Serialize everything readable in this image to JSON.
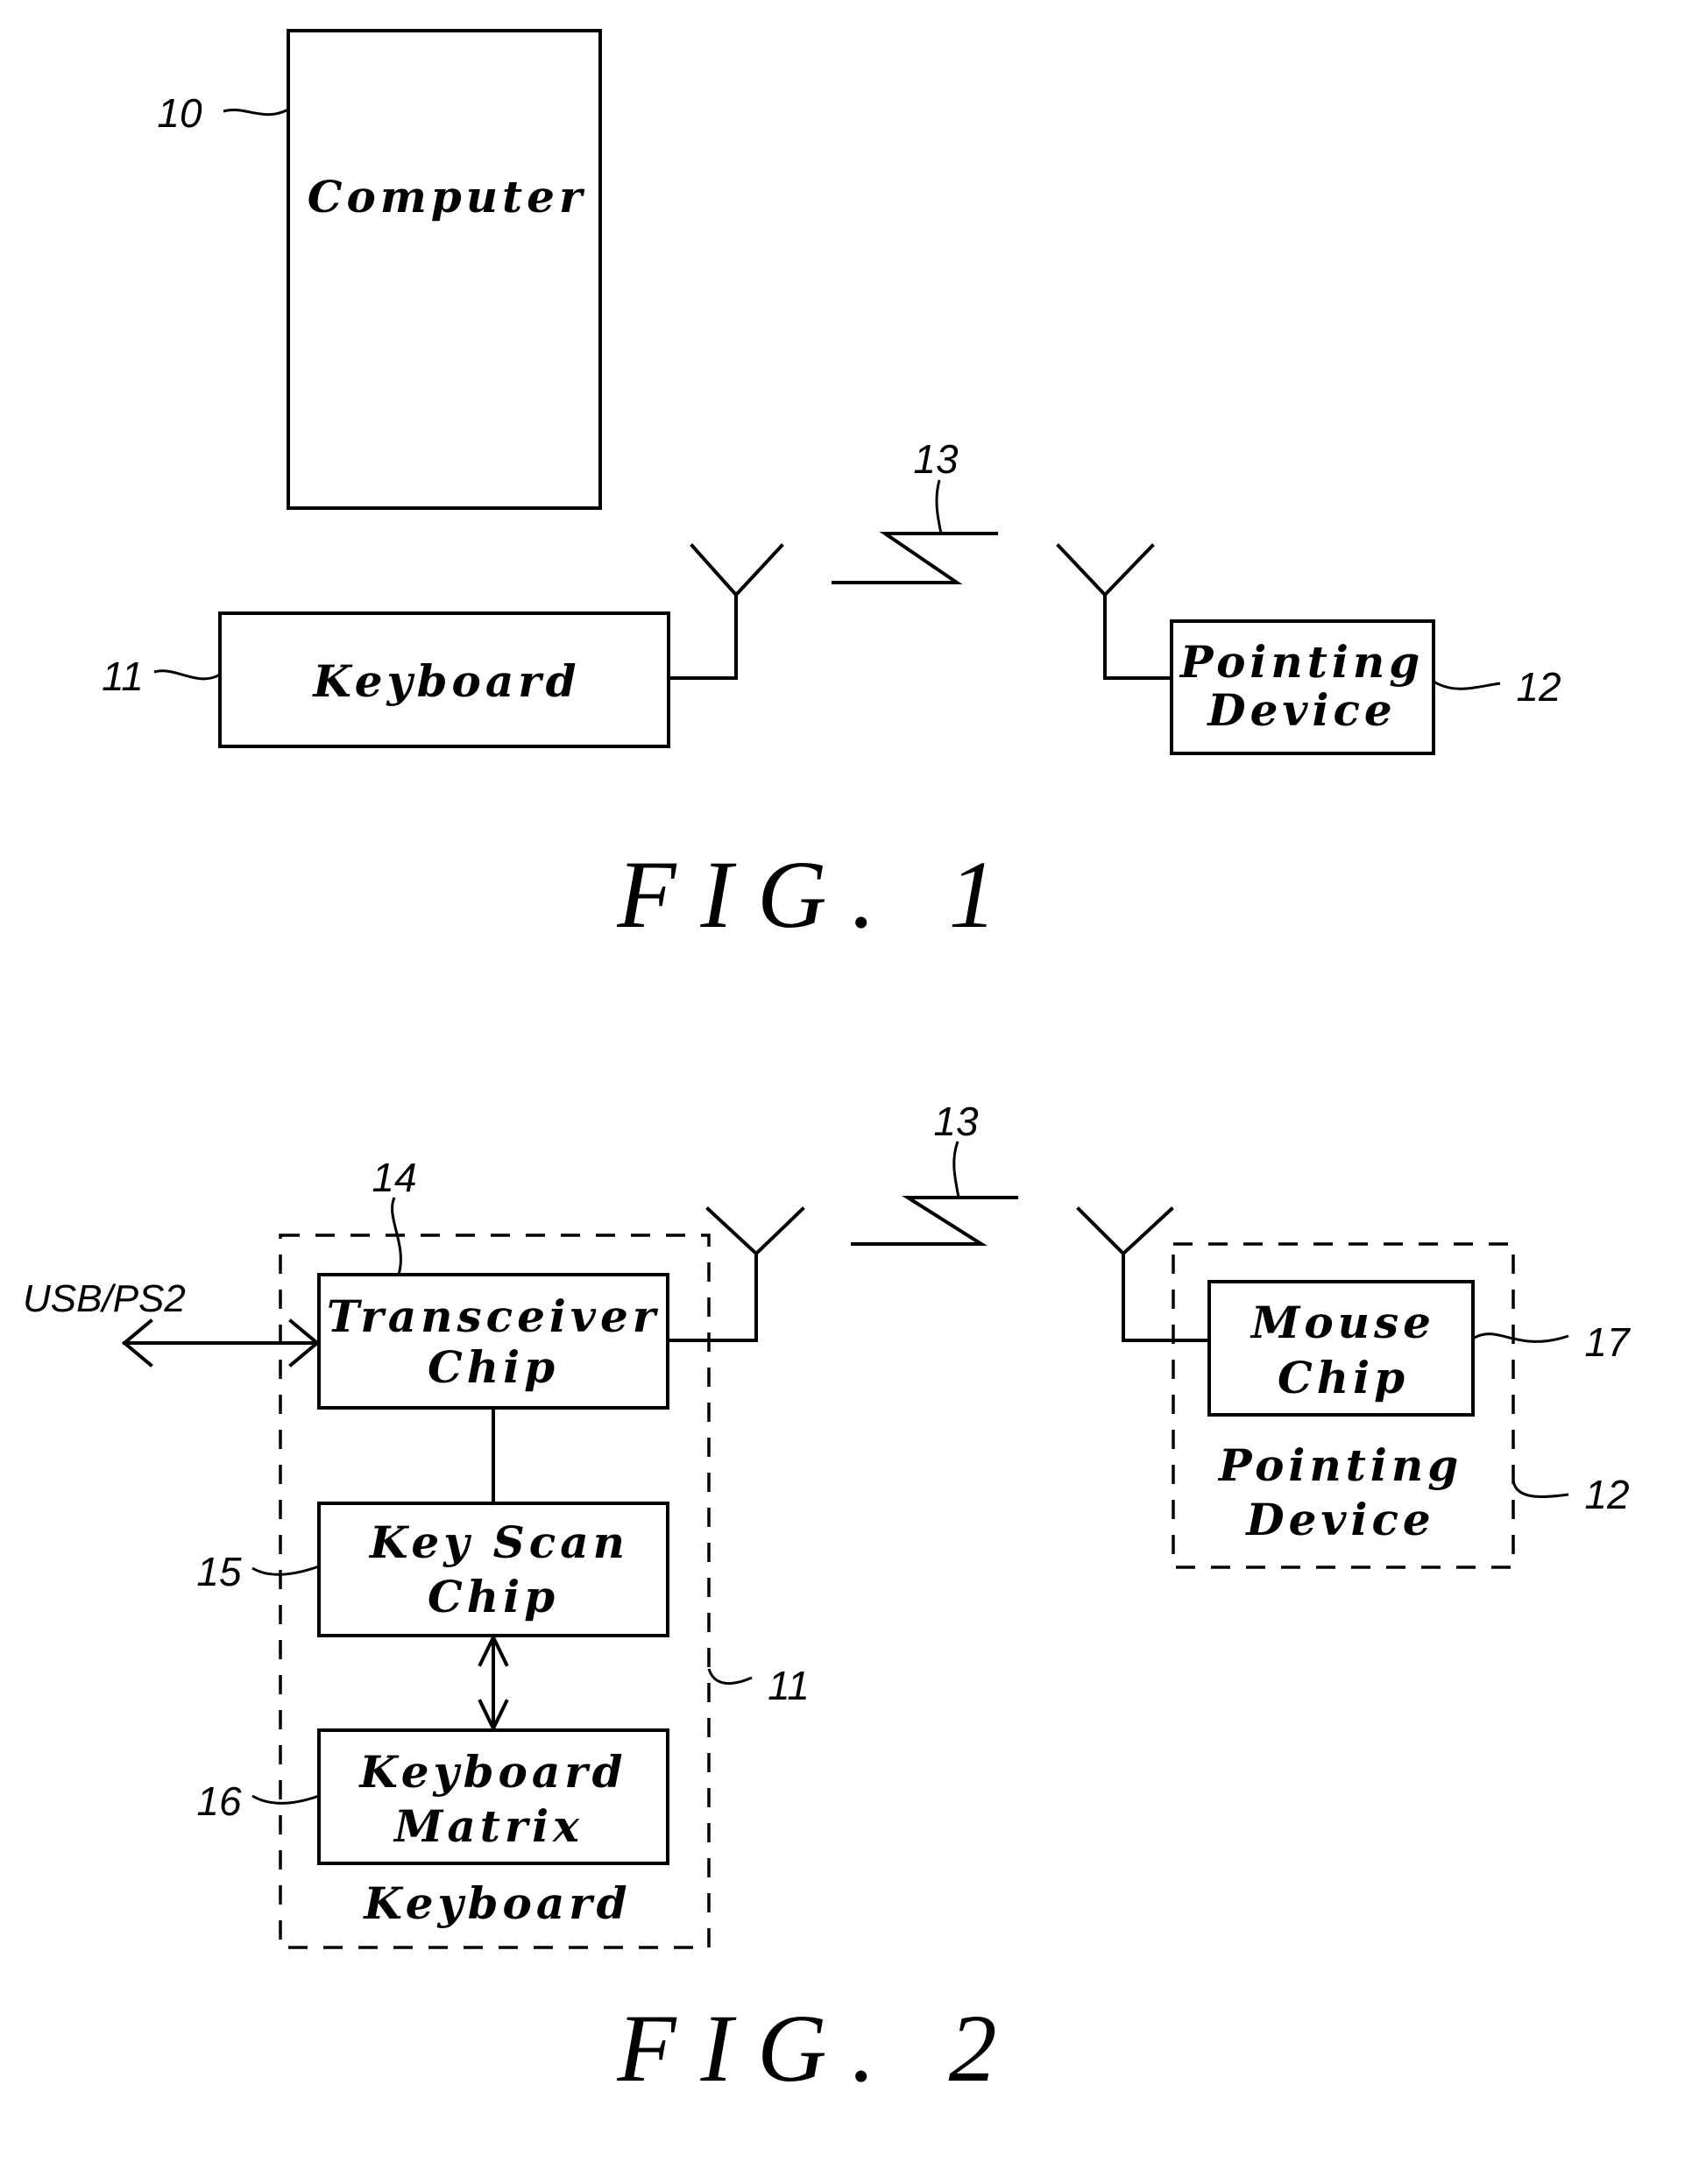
{
  "figure1": {
    "caption": "FIG. 1",
    "blocks": {
      "computer": {
        "label": "Computer",
        "ref": "10"
      },
      "keyboard": {
        "label": "Keyboard",
        "ref": "11"
      },
      "pointing_device": {
        "label_line1": "Pointing",
        "label_line2": "Device",
        "ref": "12"
      }
    },
    "wireless_link": {
      "ref": "13"
    }
  },
  "figure2": {
    "caption": "FIG. 2",
    "interface_label": "USB/PS2",
    "keyboard_group": {
      "label": "Keyboard",
      "ref": "11"
    },
    "blocks": {
      "transceiver_chip": {
        "label_line1": "Transceiver",
        "label_line2": "Chip",
        "ref": "14"
      },
      "key_scan_chip": {
        "label_line1": "Key Scan",
        "label_line2": "Chip",
        "ref": "15"
      },
      "keyboard_matrix": {
        "label_line1": "Keyboard",
        "label_line2": "Matrix",
        "ref": "16"
      },
      "mouse_chip": {
        "label_line1": "Mouse",
        "label_line2": "Chip",
        "ref": "17"
      }
    },
    "pointing_group": {
      "label_line1": "Pointing",
      "label_line2": "Device",
      "ref": "12"
    },
    "wireless_link": {
      "ref": "13"
    }
  }
}
